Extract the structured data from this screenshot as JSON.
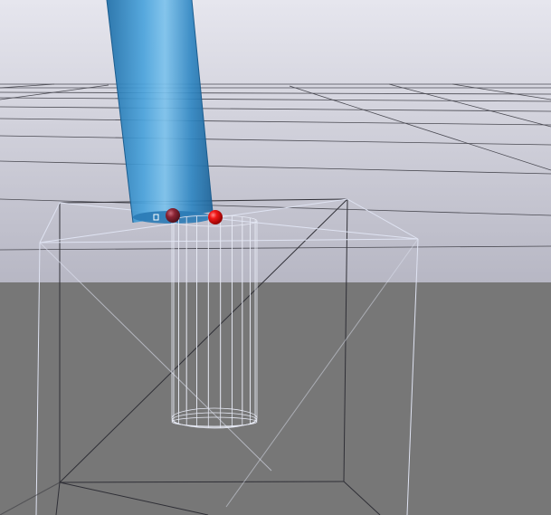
{
  "scene": {
    "colors": {
      "sky_top": "#e4e4ec",
      "sky_bottom": "#b9b9c6",
      "ground": "#777777",
      "grid_line": "#4a4a52",
      "wireframe_dark": "#2f2f36",
      "wireframe_light": "#dfe3f2",
      "cylinder_blue": "#2f86c2",
      "cylinder_highlight": "#8ac8ee",
      "marker_red": "#e01010",
      "marker_dark_red": "#8a2434"
    },
    "objects": {
      "grid": "floor-grid",
      "tilted_cylinder": "blue-tilted-cylinder",
      "wire_cylinder": "wireframe-cylinder",
      "bounding_box": "wireframe-box",
      "markers": [
        "red-contact-sphere",
        "dark-contact-sphere"
      ]
    }
  }
}
